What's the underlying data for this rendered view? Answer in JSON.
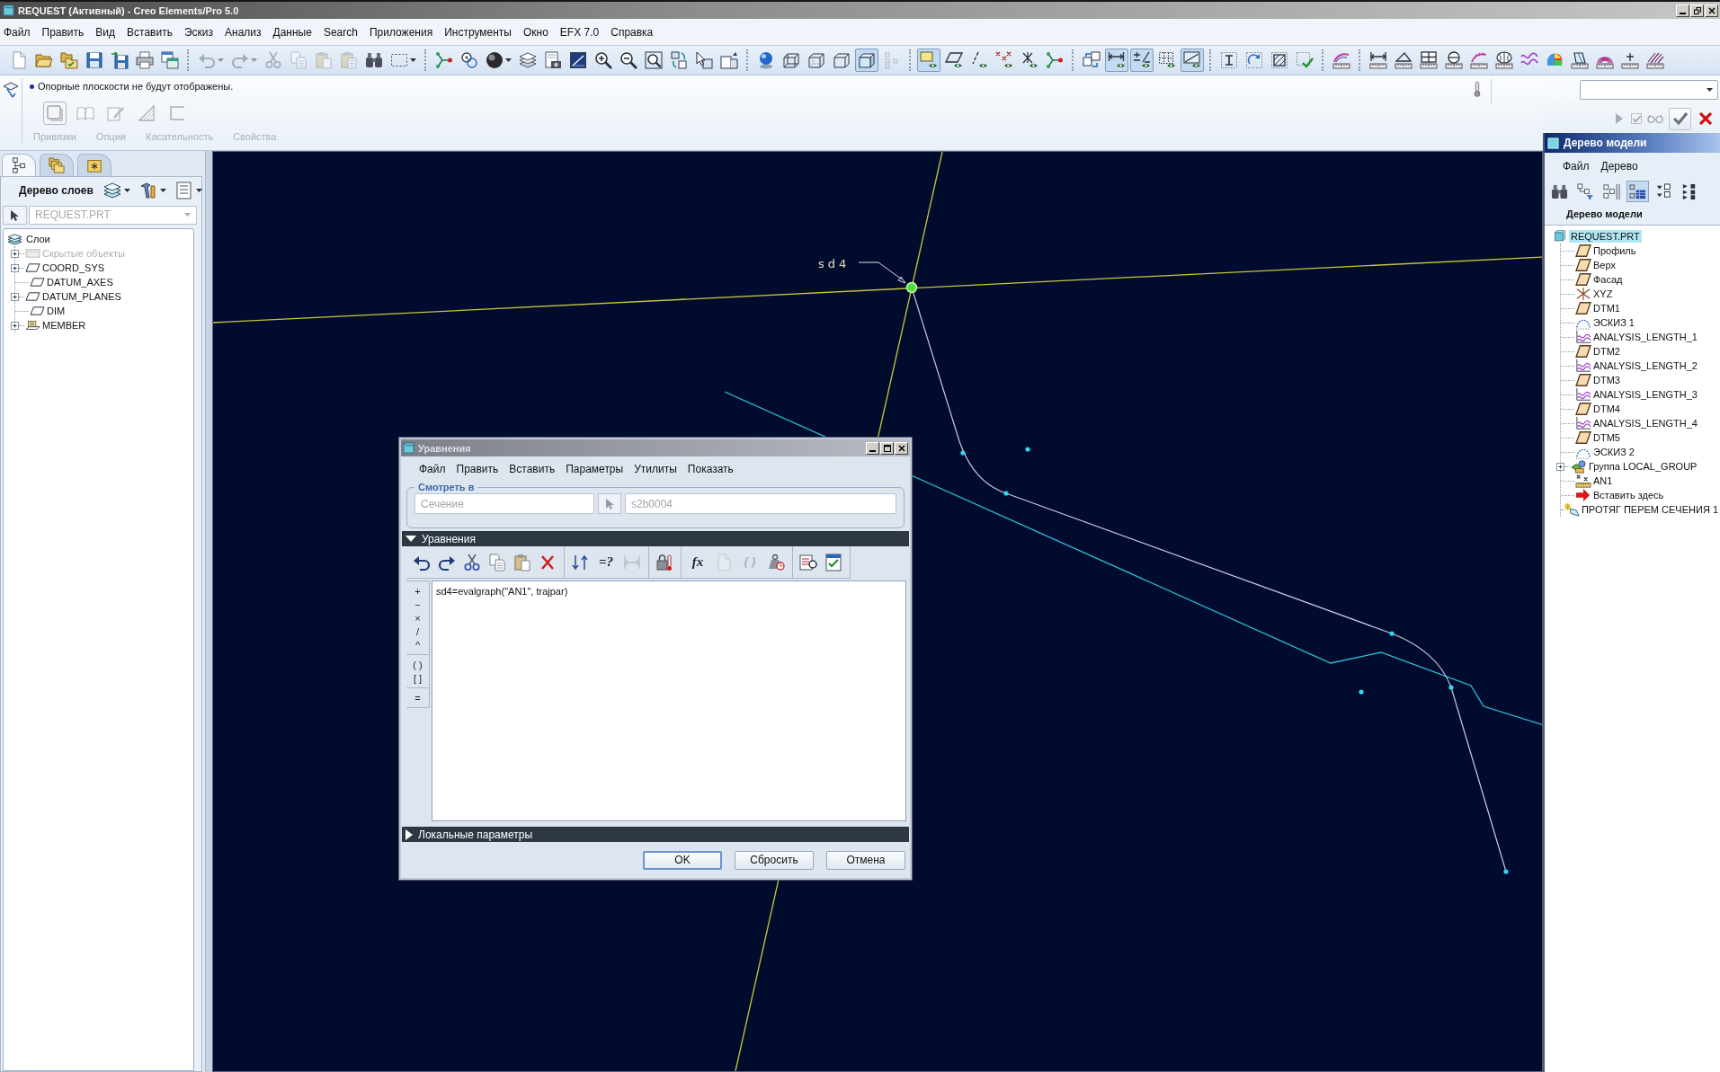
{
  "window": {
    "title": "REQUEST (Активный) - Creo Elements/Pro 5.0"
  },
  "menu": [
    "Файл",
    "Править",
    "Вид",
    "Вставить",
    "Эскиз",
    "Анализ",
    "Данные",
    "Search",
    "Приложения",
    "Инструменты",
    "Окно",
    "EFX 7.0",
    "Справка"
  ],
  "toolbar": [
    [
      {
        "kind": "new",
        "on": false,
        "disabled": false
      },
      {
        "kind": "open",
        "on": false,
        "disabled": false
      },
      {
        "kind": "folders",
        "on": false,
        "disabled": false
      },
      {
        "kind": "save",
        "on": false,
        "disabled": false
      },
      {
        "kind": "save-copy",
        "on": false,
        "disabled": false
      },
      {
        "kind": "print",
        "on": false,
        "disabled": false
      },
      {
        "kind": "windows",
        "on": false,
        "disabled": false
      }
    ],
    [
      {
        "kind": "undo",
        "on": false,
        "disabled": true
      },
      {
        "kind": "redo",
        "on": false,
        "disabled": true
      },
      {
        "kind": "cut",
        "on": false,
        "disabled": true
      },
      {
        "kind": "copy",
        "on": false,
        "disabled": true
      },
      {
        "kind": "paste",
        "on": false,
        "disabled": true
      },
      {
        "kind": "paste-special",
        "on": false,
        "disabled": true
      },
      {
        "kind": "find",
        "on": false,
        "disabled": false
      },
      {
        "kind": "select",
        "on": false,
        "disabled": false
      }
    ],
    [
      {
        "kind": "relations",
        "on": false,
        "disabled": false
      },
      {
        "kind": "regen",
        "on": false,
        "disabled": false
      },
      {
        "kind": "sphere",
        "on": false,
        "disabled": false
      },
      {
        "kind": "layers",
        "on": false,
        "disabled": false
      },
      {
        "kind": "saved-view",
        "on": false,
        "disabled": false
      },
      {
        "kind": "view",
        "on": false,
        "disabled": false
      },
      {
        "kind": "zoom-in",
        "on": false,
        "disabled": false
      },
      {
        "kind": "zoom-out",
        "on": false,
        "disabled": false
      },
      {
        "kind": "refit",
        "on": false,
        "disabled": false
      },
      {
        "kind": "reorient",
        "on": false,
        "disabled": false
      },
      {
        "kind": "cursor-box",
        "on": false,
        "disabled": false
      },
      {
        "kind": "view-manager",
        "on": false,
        "disabled": false
      }
    ],
    [
      {
        "kind": "display",
        "on": false,
        "disabled": false
      },
      {
        "kind": "wireframe",
        "on": false,
        "disabled": false
      },
      {
        "kind": "hidden-line",
        "on": false,
        "disabled": false
      },
      {
        "kind": "no-hidden",
        "on": false,
        "disabled": false
      },
      {
        "kind": "shaded",
        "on": true,
        "disabled": false
      },
      {
        "kind": "dot-grid",
        "on": false,
        "disabled": true
      }
    ],
    [
      {
        "kind": "plane-display",
        "on": true,
        "disabled": false
      },
      {
        "kind": "parallelogram",
        "on": false,
        "disabled": false
      },
      {
        "kind": "axis-display",
        "on": false,
        "disabled": false
      },
      {
        "kind": "point-display",
        "on": false,
        "disabled": false
      },
      {
        "kind": "csys-display",
        "on": false,
        "disabled": false
      },
      {
        "kind": "nodes",
        "on": false,
        "disabled": false
      }
    ],
    [
      {
        "kind": "spin",
        "on": false,
        "disabled": false
      },
      {
        "kind": "dim-display",
        "on": true,
        "disabled": false
      },
      {
        "kind": "tol-display",
        "on": true,
        "disabled": false
      },
      {
        "kind": "grid-display",
        "on": false,
        "disabled": false
      },
      {
        "kind": "note-display",
        "on": true,
        "disabled": false
      }
    ],
    [
      {
        "kind": "ibeam",
        "on": false,
        "disabled": false
      },
      {
        "kind": "dotted-rotate",
        "on": false,
        "disabled": false
      },
      {
        "kind": "hatched-square",
        "on": false,
        "disabled": false
      },
      {
        "kind": "dotted-check",
        "on": false,
        "disabled": false
      }
    ],
    [
      {
        "kind": "surface-analysis",
        "on": false,
        "disabled": false
      }
    ],
    [
      {
        "kind": "measure",
        "on": false,
        "disabled": false
      },
      {
        "kind": "angle",
        "on": false,
        "disabled": false
      },
      {
        "kind": "area",
        "on": false,
        "disabled": false
      },
      {
        "kind": "diameter",
        "on": false,
        "disabled": false
      },
      {
        "kind": "curvature",
        "on": false,
        "disabled": false
      },
      {
        "kind": "section",
        "on": false,
        "disabled": false
      },
      {
        "kind": "wave",
        "on": false,
        "disabled": false
      },
      {
        "kind": "shade",
        "on": false,
        "disabled": false
      },
      {
        "kind": "draft",
        "on": false,
        "disabled": false
      },
      {
        "kind": "reflection",
        "on": false,
        "disabled": false
      },
      {
        "kind": "ruler",
        "on": false,
        "disabled": false
      },
      {
        "kind": "hatch",
        "on": false,
        "disabled": false
      }
    ]
  ],
  "dashboard": {
    "message": "Опорные плоскости не будут отображены.",
    "tools": [
      {
        "kind": "solid",
        "on": true,
        "disabled": true
      },
      {
        "kind": "surface",
        "on": false,
        "disabled": true
      },
      {
        "kind": "sketch",
        "on": false,
        "disabled": true
      },
      {
        "kind": "thin",
        "on": false,
        "disabled": true
      },
      {
        "kind": "open",
        "on": false,
        "disabled": true
      }
    ],
    "tabs": [
      {
        "label": "Привязки",
        "disabled": true
      },
      {
        "label": "Опции",
        "disabled": true
      },
      {
        "label": "Касательность",
        "disabled": true
      },
      {
        "label": "Свойства",
        "disabled": true
      }
    ],
    "resume": {
      "disabled": true
    },
    "preview": {
      "checked": true,
      "disabled": true
    }
  },
  "layer_panel": {
    "tabs": [
      {
        "kind": "tree",
        "selected": true
      },
      {
        "kind": "folders",
        "selected": false
      },
      {
        "kind": "favorites",
        "selected": false
      }
    ],
    "title": "Дерево слоев",
    "model": {
      "value": "REQUEST.PRT",
      "disabled": true
    },
    "tree": {
      "label": "Слои",
      "children": [
        {
          "label": "Скрытые объекты",
          "kind": "hidden",
          "expandable": true,
          "disabled": true
        },
        {
          "label": "COORD_SYS",
          "kind": "layer",
          "expandable": true,
          "disabled": false
        },
        {
          "label": "DATUM_AXES",
          "kind": "layer",
          "expandable": false,
          "disabled": false
        },
        {
          "label": "DATUM_PLANES",
          "kind": "layer",
          "expandable": true,
          "disabled": false
        },
        {
          "label": "DIM",
          "kind": "layer",
          "expandable": false,
          "disabled": false
        },
        {
          "label": "MEMBER",
          "kind": "rule",
          "expandable": true,
          "disabled": false
        }
      ]
    }
  },
  "viewport": {
    "dimension_label": "sd4"
  },
  "equations_dialog": {
    "title": "Уравнения",
    "menu": [
      "Файл",
      "Править",
      "Вставить",
      "Параметры",
      "Утилиты",
      "Показать"
    ],
    "look_in": {
      "label": "Смотреть в",
      "type": {
        "value": "Сечение",
        "disabled": true
      },
      "pick": {
        "disabled": true
      },
      "item": {
        "value": "s2b0004",
        "disabled": true
      }
    },
    "equations": {
      "label": "Уравнения",
      "expanded": true,
      "toolbar": [
        [
          {
            "kind": "undo",
            "disabled": false
          },
          {
            "kind": "redo",
            "disabled": false
          },
          {
            "kind": "cut",
            "disabled": false
          },
          {
            "kind": "copy",
            "disabled": false
          },
          {
            "kind": "paste",
            "disabled": false
          },
          {
            "kind": "delete",
            "disabled": false
          }
        ],
        [
          {
            "kind": "sort",
            "disabled": false
          },
          {
            "kind": "text",
            "label": "=?",
            "disabled": false
          },
          {
            "kind": "dimension",
            "disabled": true
          }
        ],
        [
          {
            "kind": "units",
            "disabled": false
          }
        ],
        [
          {
            "kind": "text",
            "label": "fx",
            "disabled": false
          },
          {
            "kind": "page",
            "disabled": true
          },
          {
            "kind": "text",
            "label": "{ }",
            "disabled": true
          },
          {
            "kind": "weight",
            "disabled": false
          }
        ],
        [
          {
            "kind": "list",
            "disabled": false
          },
          {
            "kind": "check",
            "disabled": false
          }
        ]
      ],
      "operators": [
        [
          "+",
          "−",
          "×",
          "/",
          "^"
        ],
        [
          "( )",
          "[ ]"
        ],
        [
          "="
        ]
      ],
      "text": "sd4=evalgraph(\"AN1\", trajpar)"
    },
    "local": {
      "label": "Локальные параметры",
      "expanded": false
    },
    "buttons": [
      {
        "label": "OK",
        "default": true
      },
      {
        "label": "Сбросить",
        "default": false
      },
      {
        "label": "Отмена",
        "default": false
      }
    ]
  },
  "model_tree": {
    "title": "Дерево модели",
    "menu": [
      "Файл",
      "Дерево"
    ],
    "toolbar": [
      {
        "kind": "find",
        "on": false
      },
      {
        "kind": "filter",
        "on": false
      },
      {
        "kind": "columns",
        "on": false
      },
      {
        "kind": "settings",
        "on": true
      },
      {
        "kind": "expand",
        "on": false
      },
      {
        "kind": "collapse",
        "on": false
      }
    ],
    "heading": "Дерево модели",
    "root": {
      "label": "REQUEST.PRT",
      "kind": "part",
      "selected": true,
      "children": [
        {
          "label": "Профиль",
          "kind": "plane",
          "expandable": false,
          "selected": false
        },
        {
          "label": "Верх",
          "kind": "plane",
          "expandable": false,
          "selected": false
        },
        {
          "label": "Фасад",
          "kind": "plane",
          "expandable": false,
          "selected": false
        },
        {
          "label": "XYZ",
          "kind": "csys",
          "expandable": false,
          "selected": false
        },
        {
          "label": "DTM1",
          "kind": "plane",
          "expandable": false,
          "selected": false
        },
        {
          "label": "ЭСКИЗ 1",
          "kind": "sketch",
          "expandable": false,
          "selected": false
        },
        {
          "label": "ANALYSIS_LENGTH_1",
          "kind": "analysis",
          "expandable": false,
          "selected": false
        },
        {
          "label": "DTM2",
          "kind": "plane",
          "expandable": false,
          "selected": false
        },
        {
          "label": "ANALYSIS_LENGTH_2",
          "kind": "analysis",
          "expandable": false,
          "selected": false
        },
        {
          "label": "DTM3",
          "kind": "plane",
          "expandable": false,
          "selected": false
        },
        {
          "label": "ANALYSIS_LENGTH_3",
          "kind": "analysis",
          "expandable": false,
          "selected": false
        },
        {
          "label": "DTM4",
          "kind": "plane",
          "expandable": false,
          "selected": false
        },
        {
          "label": "ANALYSIS_LENGTH_4",
          "kind": "analysis",
          "expandable": false,
          "selected": false
        },
        {
          "label": "DTM5",
          "kind": "plane",
          "expandable": false,
          "selected": false
        },
        {
          "label": "ЭСКИЗ 2",
          "kind": "sketch",
          "expandable": false,
          "selected": false
        },
        {
          "label": "Группа LOCAL_GROUP",
          "kind": "group",
          "expandable": true,
          "selected": false
        },
        {
          "label": "AN1",
          "kind": "point-analysis",
          "expandable": false,
          "selected": false
        },
        {
          "label": "Вставить здесь",
          "kind": "insert",
          "expandable": false,
          "selected": false
        },
        {
          "label": "ПРОТЯГ ПЕРЕМ СЕЧЕНИЯ 1",
          "kind": "sweep",
          "expandable": false,
          "selected": false
        }
      ]
    }
  }
}
